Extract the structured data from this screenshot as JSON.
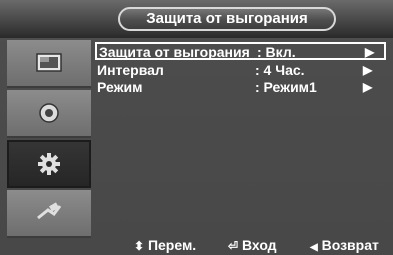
{
  "menu_title": "Защита от выгорания",
  "sidebar": [
    {
      "icon": "picture-icon"
    },
    {
      "icon": "sound-icon"
    },
    {
      "icon": "setup-gear-icon"
    },
    {
      "icon": "input-plug-icon"
    }
  ],
  "rows": [
    {
      "label": "Защита от выгорания",
      "value": ": Вкл.",
      "arrow": "▶"
    },
    {
      "label": "Интервал",
      "value": ": 4 Час.",
      "arrow": "▶"
    },
    {
      "label": "Режим",
      "value": ": Режим1",
      "arrow": "▶"
    }
  ],
  "footer": {
    "move_icon": "⬍",
    "move_label": "Перем.",
    "enter_icon": "⏎",
    "enter_label": "Вход",
    "return_icon": "◀",
    "return_label": "Возврат"
  }
}
